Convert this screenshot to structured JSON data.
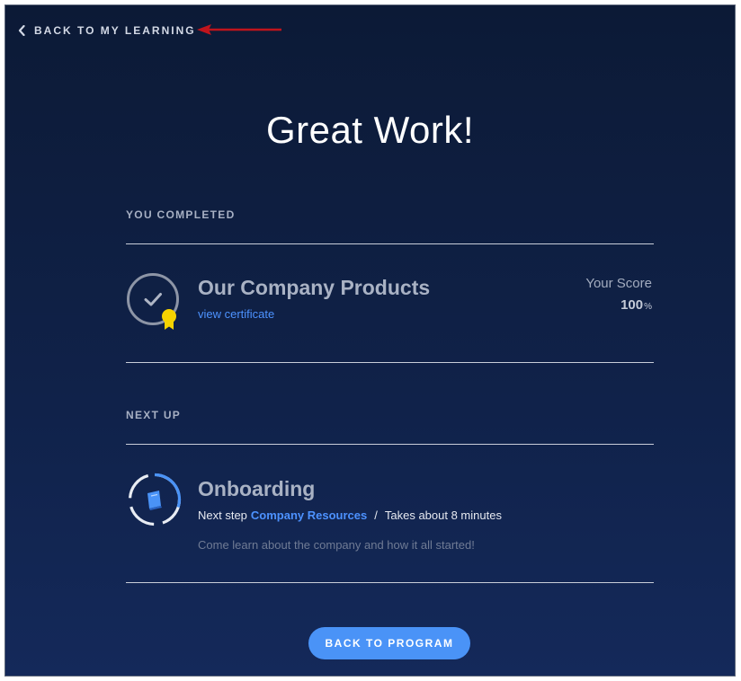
{
  "nav": {
    "back_label": "BACK TO MY LEARNING",
    "back_icon": "chevron-left-icon"
  },
  "title": "Great Work!",
  "completed": {
    "section_label": "YOU COMPLETED",
    "course_title": "Our Company Products",
    "certificate_link": "view certificate",
    "score_label": "Your Score",
    "score_value": "100",
    "score_unit": "%",
    "icon": "completed-check-badge-icon"
  },
  "next_up": {
    "section_label": "NEXT UP",
    "course_title": "Onboarding",
    "next_step_prefix": "Next step",
    "next_step_link": "Company Resources",
    "separator": "/",
    "duration": "Takes about 8 minutes",
    "description": "Come learn about the company and how it all started!",
    "progress": 0.3,
    "icon": "book-progress-icon"
  },
  "button": {
    "label": "BACK TO PROGRAM"
  },
  "colors": {
    "background": "#0c1a36",
    "accent": "#4a93f7",
    "link": "#4d92ff",
    "badge": "#f6d300",
    "annotation_arrow": "#c0141c"
  }
}
